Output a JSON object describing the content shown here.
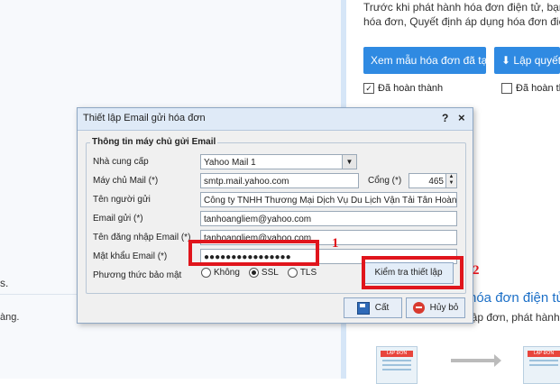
{
  "background": {
    "intro_lines": [
      "Trước khi phát hành hóa đơn điện tử, bạn cần",
      "hóa đơn, Quyết định áp dụng hóa đơn điện tử"
    ],
    "btn_view_template": "Xem mẫu hóa đơn đã tạo",
    "btn_create_decision": "Lập quyết",
    "done_label_1": "Đã hoàn thành",
    "done_label_2": "Đã hoàn thà",
    "section_title": "hóa đơn điện tử",
    "section_sub": "lập đơn, phát hành hó",
    "left_text_1": "s.",
    "left_text_2": "àng.",
    "doc_card_label": "LẬP ĐƠN"
  },
  "dialog": {
    "title": "Thiết lập Email gửi hóa đơn",
    "help_label": "?",
    "close_label": "×",
    "group_title": "Thông tin máy chủ gửi Email",
    "fields": {
      "provider_label": "Nhà cung cấp",
      "provider_value": "Yahoo Mail 1",
      "server_label": "Máy chủ Mail (*)",
      "server_value": "smtp.mail.yahoo.com",
      "port_label": "Cổng (*)",
      "port_value": "465",
      "sender_name_label": "Tên người gửi",
      "sender_name_value": "Công ty TNHH Thương Mại Dịch Vụ Du Lịch Vận Tải Tân Hoàng",
      "email_label": "Email gửi (*)",
      "email_value": "tanhoangliem@yahoo.com",
      "login_label": "Tên đăng nhập Email (*)",
      "login_value": "tanhoangliem@yahoo.com",
      "password_label": "Mật khẩu Email (*)",
      "password_value": "●●●●●●●●●●●●●●●●",
      "security_label": "Phương thức bảo mật",
      "security_options": [
        "Không",
        "SSL",
        "TLS"
      ],
      "security_selected": "SSL"
    },
    "test_button": "Kiểm tra thiết lập",
    "save_button": "Cất",
    "cancel_button": "Hủy bỏ"
  },
  "annotations": {
    "marker_1": "1",
    "marker_2": "2",
    "color": "#e0151c"
  }
}
